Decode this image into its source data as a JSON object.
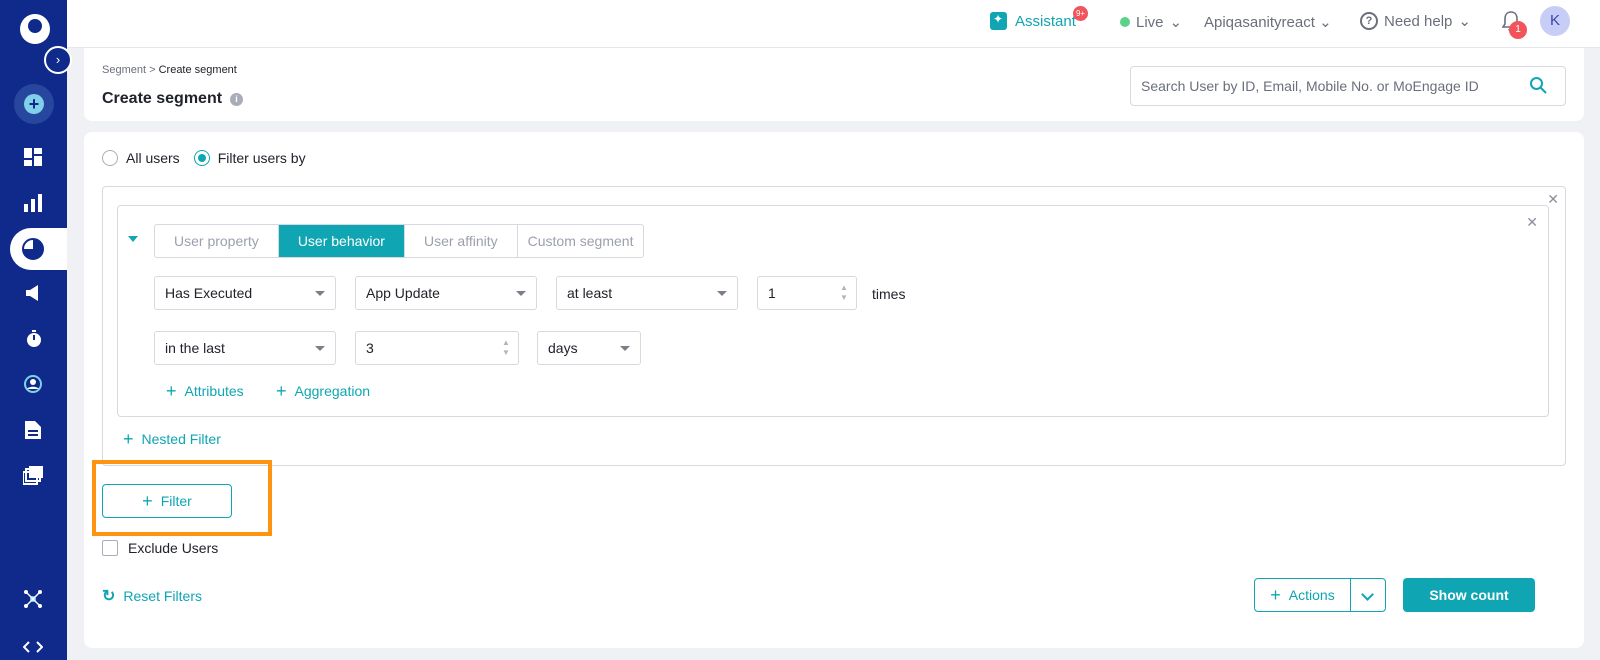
{
  "header": {
    "assistant_label": "Assistant",
    "assistant_badge": "9+",
    "live_label": "Live",
    "account_label": "Apiqasanityreact",
    "help_label": "Need help",
    "notification_count": "1",
    "avatar_initial": "K"
  },
  "page": {
    "breadcrumb_root": "Segment",
    "breadcrumb_sep": ">",
    "breadcrumb_current": "Create segment",
    "title": "Create segment",
    "search_placeholder": "Search User by ID, Email, Mobile No. or MoEngage ID"
  },
  "audience": {
    "all_users_label": "All users",
    "filter_users_label": "Filter users by",
    "selected": "filter"
  },
  "filter": {
    "tabs": [
      {
        "label": "User property"
      },
      {
        "label": "User behavior"
      },
      {
        "label": "User affinity"
      },
      {
        "label": "Custom segment"
      }
    ],
    "active_tab": "User behavior",
    "row1": {
      "condition": "Has Executed",
      "event": "App Update",
      "frequency": "at least",
      "count": "1",
      "count_unit": "times"
    },
    "row2": {
      "time_window": "in the last",
      "duration": "3",
      "duration_unit": "days"
    },
    "attributes_label": "Attributes",
    "aggregation_label": "Aggregation",
    "nested_filter_label": "Nested Filter"
  },
  "controls": {
    "add_filter_label": "Filter",
    "exclude_users_label": "Exclude Users",
    "reset_filters_label": "Reset Filters",
    "actions_label": "Actions",
    "show_count_label": "Show count"
  },
  "colors": {
    "sidebar": "#0f2a8a",
    "accent": "#0fa5b3",
    "highlight": "#ff9412",
    "badge": "#f2545b"
  }
}
